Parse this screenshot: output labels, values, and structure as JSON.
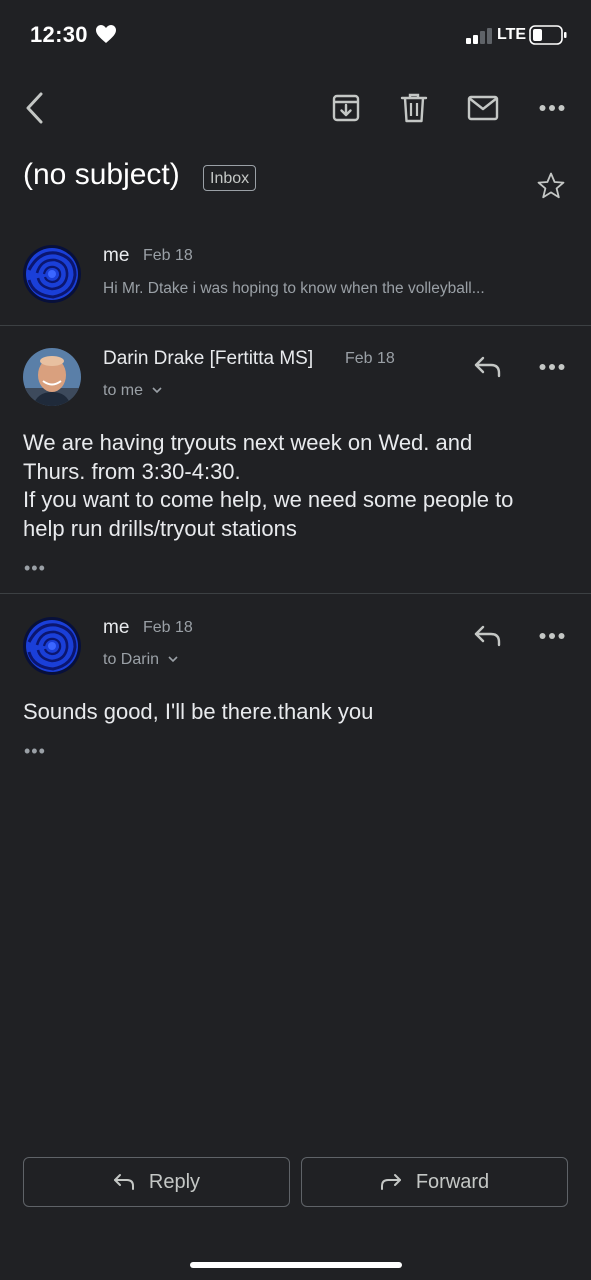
{
  "status": {
    "time": "12:30",
    "network": "LTE"
  },
  "subject": "(no subject)",
  "label": "Inbox",
  "messages": [
    {
      "sender": "me",
      "date": "Feb 18",
      "snippet": "Hi Mr. Dtake i was hoping to know when the volleyball..."
    },
    {
      "sender": "Darin Drake [Fertitta MS]",
      "date": "Feb 18",
      "recipient": "to me",
      "body": [
        "We are having tryouts next week on Wed. and",
        "Thurs. from 3:30-4:30.",
        "If you want to come help, we need some people to",
        "help run drills/tryout stations"
      ],
      "ellipsis": "•••"
    },
    {
      "sender": "me",
      "date": "Feb 18",
      "recipient": "to Darin",
      "body": [
        "Sounds good, I'll be there.thank you"
      ],
      "ellipsis": "•••"
    }
  ],
  "actions": {
    "reply": "Reply",
    "forward": "Forward"
  },
  "colors": {
    "background": "#202124",
    "text": "#e8eaed",
    "muted": "#9aa0a6",
    "avatar_blue": "#1a3fd8"
  }
}
